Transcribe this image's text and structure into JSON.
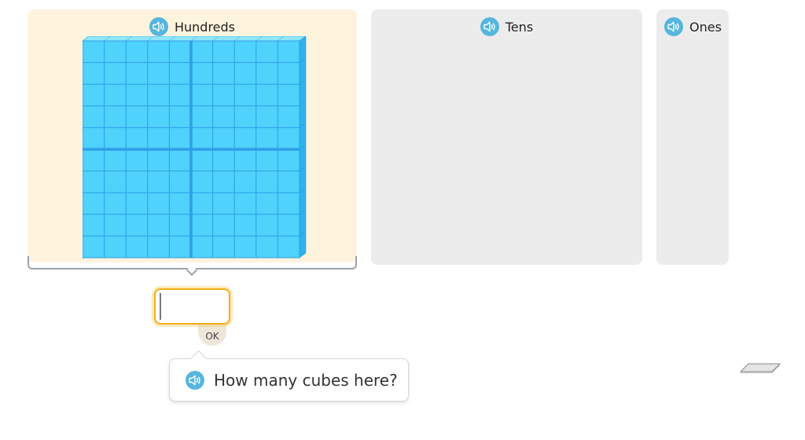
{
  "columns": {
    "hundreds": {
      "label": "Hundreds",
      "blocks": 1
    },
    "tens": {
      "label": "Tens",
      "blocks": 0
    },
    "ones": {
      "label": "Ones",
      "blocks": 0
    }
  },
  "answer": {
    "value": "",
    "ok_label": "OK"
  },
  "prompt": {
    "text": "How many cubes here?"
  },
  "icons": {
    "speaker": "speaker-icon",
    "eraser": "eraser-icon"
  },
  "colors": {
    "hundreds_bg": "#fef3dd",
    "column_bg": "#ececec",
    "cube_face": "#4fd2fb",
    "cube_grid": "#2f9ee8",
    "speaker": "#55b6de",
    "input_highlight": "#f3ad1c"
  }
}
